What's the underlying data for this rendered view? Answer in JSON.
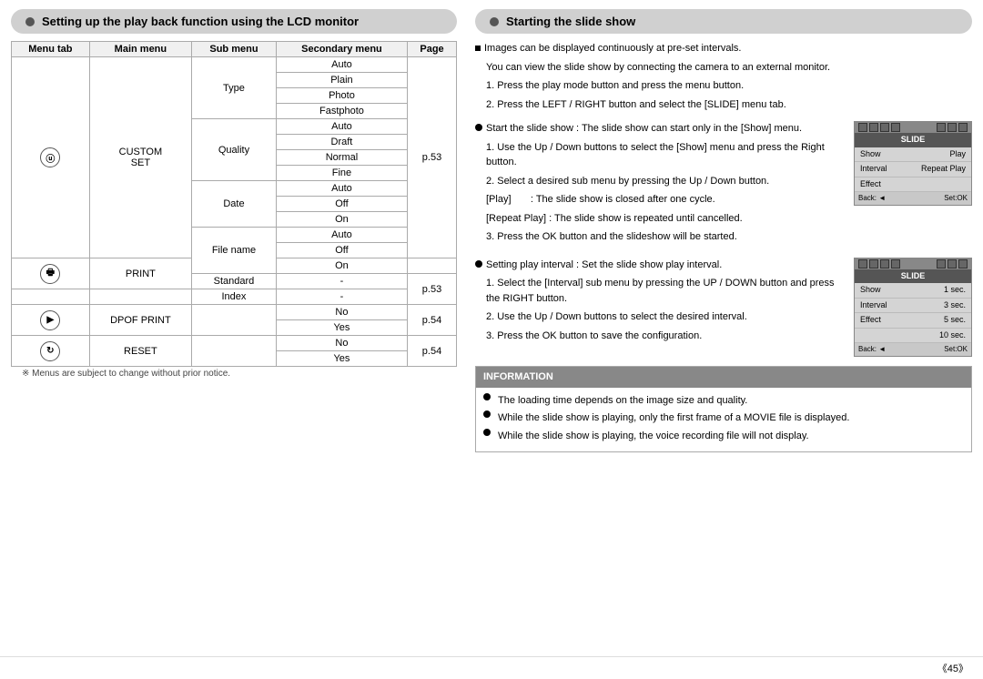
{
  "left": {
    "header": "Setting up the play back function using the LCD monitor",
    "table": {
      "columns": [
        "Menu tab",
        "Main menu",
        "Sub menu",
        "Secondary menu",
        "Page"
      ],
      "rows": [
        {
          "icon": "camera",
          "main": "CUSTOM\nSET",
          "subs": [
            {
              "sub": "Type",
              "secondary": [
                "Auto",
                "Plain",
                "Photo",
                "Fastphoto"
              ],
              "page": ""
            },
            {
              "sub": "Quality",
              "secondary": [
                "Auto",
                "Draft",
                "Normal",
                "Fine"
              ],
              "page": "p.53"
            },
            {
              "sub": "Date",
              "secondary": [
                "Auto",
                "Off",
                "On"
              ],
              "page": ""
            },
            {
              "sub": "File name",
              "secondary": [
                "Auto",
                "Off",
                "On"
              ],
              "page": ""
            }
          ]
        },
        {
          "icon": "print",
          "main": "PRINT",
          "subs": [
            {
              "sub": "Standard",
              "secondary": [
                "-"
              ],
              "page": "p.53"
            },
            {
              "sub": "Index",
              "secondary": [
                "-"
              ],
              "page": ""
            }
          ]
        },
        {
          "icon": "dpof",
          "main": "DPOF PRINT",
          "subs": [
            {
              "sub": "",
              "secondary": [
                "No",
                "Yes"
              ],
              "page": "p.54"
            }
          ]
        },
        {
          "icon": "reset",
          "main": "RESET",
          "subs": [
            {
              "sub": "",
              "secondary": [
                "No",
                "Yes"
              ],
              "page": "p.54"
            }
          ]
        }
      ]
    },
    "footnote": "※ Menus are subject to change without prior notice."
  },
  "right": {
    "header": "Starting the slide show",
    "intro": [
      "■ Images can be displayed continuously at pre-set intervals.",
      "You can view the slide show by connecting the camera to an external monitor.",
      "1. Press the play mode button and press the menu button.",
      "2. Press the LEFT / RIGHT button and select the [SLIDE] menu tab."
    ],
    "sections": [
      {
        "bullet": "circle",
        "text": "Start the slide show : The slide show can start only in the [Show] menu.",
        "steps": [
          "1. Use the Up / Down buttons to select the [Show] menu and press the Right button.",
          "2. Select a desired sub menu by pressing the Up / Down button.",
          "[Play]       : The slide show is closed after one cycle.",
          "[Repeat Play] : The slide show is repeated until cancelled.",
          "3. Press the OK button and the slideshow will be started."
        ],
        "ui": {
          "icons_top": [
            "cam",
            "vid",
            "img",
            "spk",
            "prev",
            "play",
            "next"
          ],
          "title": "SLIDE",
          "rows": [
            {
              "label": "Show",
              "value": "Play"
            },
            {
              "label": "Interval",
              "value": "Repeat Play"
            },
            {
              "label": "Effect",
              "value": ""
            }
          ],
          "footer": {
            "back": "Back: ◄",
            "ok": "Set:OK"
          }
        }
      },
      {
        "bullet": "circle",
        "text": "Setting play interval : Set the slide show play interval.",
        "steps": [
          "1. Select the [Interval] sub menu by pressing the UP / DOWN button and press the RIGHT button.",
          "2. Use the Up / Down buttons to select the desired interval.",
          "3. Press the OK button to save the configuration."
        ],
        "ui": {
          "icons_top": [
            "cam",
            "vid",
            "img",
            "spk",
            "prev",
            "play",
            "next"
          ],
          "title": "SLIDE",
          "rows": [
            {
              "label": "Show",
              "value": "1 sec."
            },
            {
              "label": "Interval",
              "value": "3 sec."
            },
            {
              "label": "Effect",
              "value": "5 sec."
            },
            {
              "label": "",
              "value": "10 sec."
            }
          ],
          "footer": {
            "back": "Back: ◄",
            "ok": "Set:OK"
          }
        }
      }
    ],
    "information": {
      "title": "INFORMATION",
      "items": [
        "The loading time depends on the image size and quality.",
        "While the slide show is playing, only the first frame of a MOVIE file is displayed.",
        "While the slide show is playing, the voice recording file will not display."
      ]
    }
  },
  "footer": {
    "page": "《45》"
  }
}
